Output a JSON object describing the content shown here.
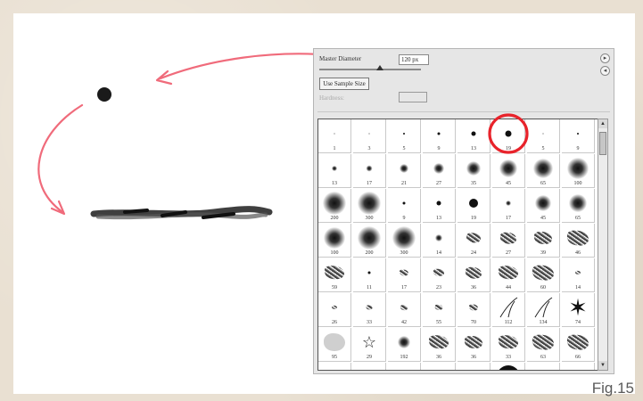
{
  "figure": {
    "caption": "Fig.15"
  },
  "brushes_panel": {
    "master_diameter": {
      "label": "Master Diameter",
      "value": "120 px",
      "slider_position": 0.6
    },
    "use_sample_size_button": "Use Sample Size",
    "hardness_label": "Hardness:",
    "side_icons": [
      "▸",
      "◂"
    ],
    "scroll_up": "▲",
    "scroll_down": "▼",
    "selected_preset": "13",
    "highlight_color": "#e8232b",
    "arrow_color": "#f06b7b",
    "presets": [
      {
        "size": "1",
        "kind": "hard",
        "dot": 1
      },
      {
        "size": "3",
        "kind": "hard",
        "dot": 1
      },
      {
        "size": "5",
        "kind": "hard",
        "dot": 2
      },
      {
        "size": "9",
        "kind": "hard",
        "dot": 3
      },
      {
        "size": "13",
        "kind": "hard",
        "dot": 5
      },
      {
        "size": "19",
        "kind": "hard",
        "dot": 7
      },
      {
        "size": "5",
        "kind": "hard",
        "dot": 1
      },
      {
        "size": "9",
        "kind": "hard",
        "dot": 2
      },
      {
        "size": "13",
        "kind": "soft",
        "dot": 6
      },
      {
        "size": "17",
        "kind": "soft",
        "dot": 7
      },
      {
        "size": "21",
        "kind": "soft",
        "dot": 10
      },
      {
        "size": "27",
        "kind": "soft",
        "dot": 12
      },
      {
        "size": "35",
        "kind": "soft",
        "dot": 16
      },
      {
        "size": "45",
        "kind": "soft",
        "dot": 20
      },
      {
        "size": "65",
        "kind": "soft",
        "dot": 22
      },
      {
        "size": "100",
        "kind": "soft",
        "dot": 24
      },
      {
        "size": "200",
        "kind": "soft",
        "dot": 26
      },
      {
        "size": "300",
        "kind": "soft",
        "dot": 26
      },
      {
        "size": "9",
        "kind": "hard",
        "dot": 3
      },
      {
        "size": "13",
        "kind": "hard",
        "dot": 5
      },
      {
        "size": "19",
        "kind": "hard",
        "dot": 10
      },
      {
        "size": "17",
        "kind": "soft",
        "dot": 6
      },
      {
        "size": "45",
        "kind": "soft",
        "dot": 18
      },
      {
        "size": "65",
        "kind": "soft",
        "dot": 20
      },
      {
        "size": "100",
        "kind": "soft",
        "dot": 24
      },
      {
        "size": "200",
        "kind": "soft",
        "dot": 26
      },
      {
        "size": "300",
        "kind": "soft",
        "dot": 26
      },
      {
        "size": "14",
        "kind": "soft",
        "dot": 8
      },
      {
        "size": "24",
        "kind": "texture",
        "dot": 16
      },
      {
        "size": "27",
        "kind": "texture",
        "dot": 18
      },
      {
        "size": "39",
        "kind": "texture",
        "dot": 20
      },
      {
        "size": "46",
        "kind": "texture",
        "dot": 24
      },
      {
        "size": "59",
        "kind": "texture",
        "dot": 22
      },
      {
        "size": "11",
        "kind": "hard",
        "dot": 3
      },
      {
        "size": "17",
        "kind": "texture",
        "dot": 10
      },
      {
        "size": "23",
        "kind": "texture",
        "dot": 12
      },
      {
        "size": "36",
        "kind": "texture",
        "dot": 18
      },
      {
        "size": "44",
        "kind": "texture",
        "dot": 22
      },
      {
        "size": "60",
        "kind": "texture",
        "dot": 24
      },
      {
        "size": "14",
        "kind": "texture",
        "dot": 6
      },
      {
        "size": "26",
        "kind": "texture",
        "dot": 6
      },
      {
        "size": "33",
        "kind": "texture",
        "dot": 7
      },
      {
        "size": "42",
        "kind": "texture",
        "dot": 8
      },
      {
        "size": "55",
        "kind": "texture",
        "dot": 9
      },
      {
        "size": "70",
        "kind": "texture",
        "dot": 10
      },
      {
        "size": "112",
        "kind": "grass",
        "dot": 26
      },
      {
        "size": "134",
        "kind": "grass",
        "dot": 26
      },
      {
        "size": "74",
        "kind": "leaf",
        "dot": 26
      },
      {
        "size": "95",
        "kind": "blob",
        "dot": 24
      },
      {
        "size": "29",
        "kind": "star",
        "dot": 18
      },
      {
        "size": "192",
        "kind": "soft",
        "dot": 14
      },
      {
        "size": "36",
        "kind": "texture",
        "dot": 22
      },
      {
        "size": "36",
        "kind": "texture",
        "dot": 20
      },
      {
        "size": "33",
        "kind": "texture",
        "dot": 22
      },
      {
        "size": "63",
        "kind": "texture",
        "dot": 24
      },
      {
        "size": "66",
        "kind": "texture",
        "dot": 24
      },
      {
        "size": "",
        "kind": "texture",
        "dot": 14
      },
      {
        "size": "",
        "kind": "texture",
        "dot": 16
      },
      {
        "size": "",
        "kind": "hard",
        "dot": 2
      },
      {
        "size": "",
        "kind": "texture",
        "dot": 18
      },
      {
        "size": "",
        "kind": "hard",
        "dot": 3
      },
      {
        "size": "",
        "kind": "hard",
        "dot": 26
      },
      {
        "size": "",
        "kind": "texture",
        "dot": 20
      },
      {
        "size": "",
        "kind": "texture",
        "dot": 22
      }
    ]
  }
}
